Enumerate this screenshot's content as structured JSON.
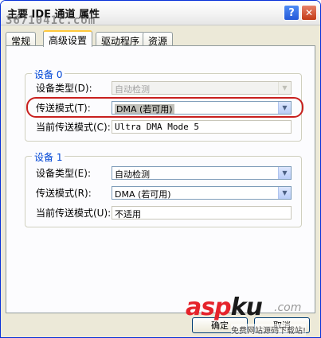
{
  "window": {
    "title": "主要 IDE 通道 属性",
    "help_glyph": "?",
    "close_glyph": "✕"
  },
  "watermark": {
    "top": "3671041c.com",
    "logo_asp": "asp",
    "logo_ku": "ku",
    "logo_com": ".com",
    "sub": "免费网站源码下载站!"
  },
  "tabs": [
    {
      "label": "常规",
      "active": false
    },
    {
      "label": "高级设置",
      "active": true
    },
    {
      "label": "驱动程序",
      "active": false
    },
    {
      "label": "资源",
      "active": false
    }
  ],
  "device0": {
    "legend": "设备 0",
    "type_label": "设备类型(D):",
    "type_value": "自动检测",
    "mode_label": "传送模式(T):",
    "mode_value": "DMA (若可用)",
    "current_label": "当前传送模式(C):",
    "current_value": "Ultra DMA Mode 5"
  },
  "device1": {
    "legend": "设备 1",
    "type_label": "设备类型(E):",
    "type_value": "自动检测",
    "mode_label": "传送模式(R):",
    "mode_value": "DMA (若可用)",
    "current_label": "当前传送模式(U):",
    "current_value": "不适用"
  },
  "buttons": {
    "ok": "确定",
    "cancel": "取消"
  },
  "colors": {
    "highlight_outline": "#c8201e",
    "legend_text": "#0046d5"
  }
}
